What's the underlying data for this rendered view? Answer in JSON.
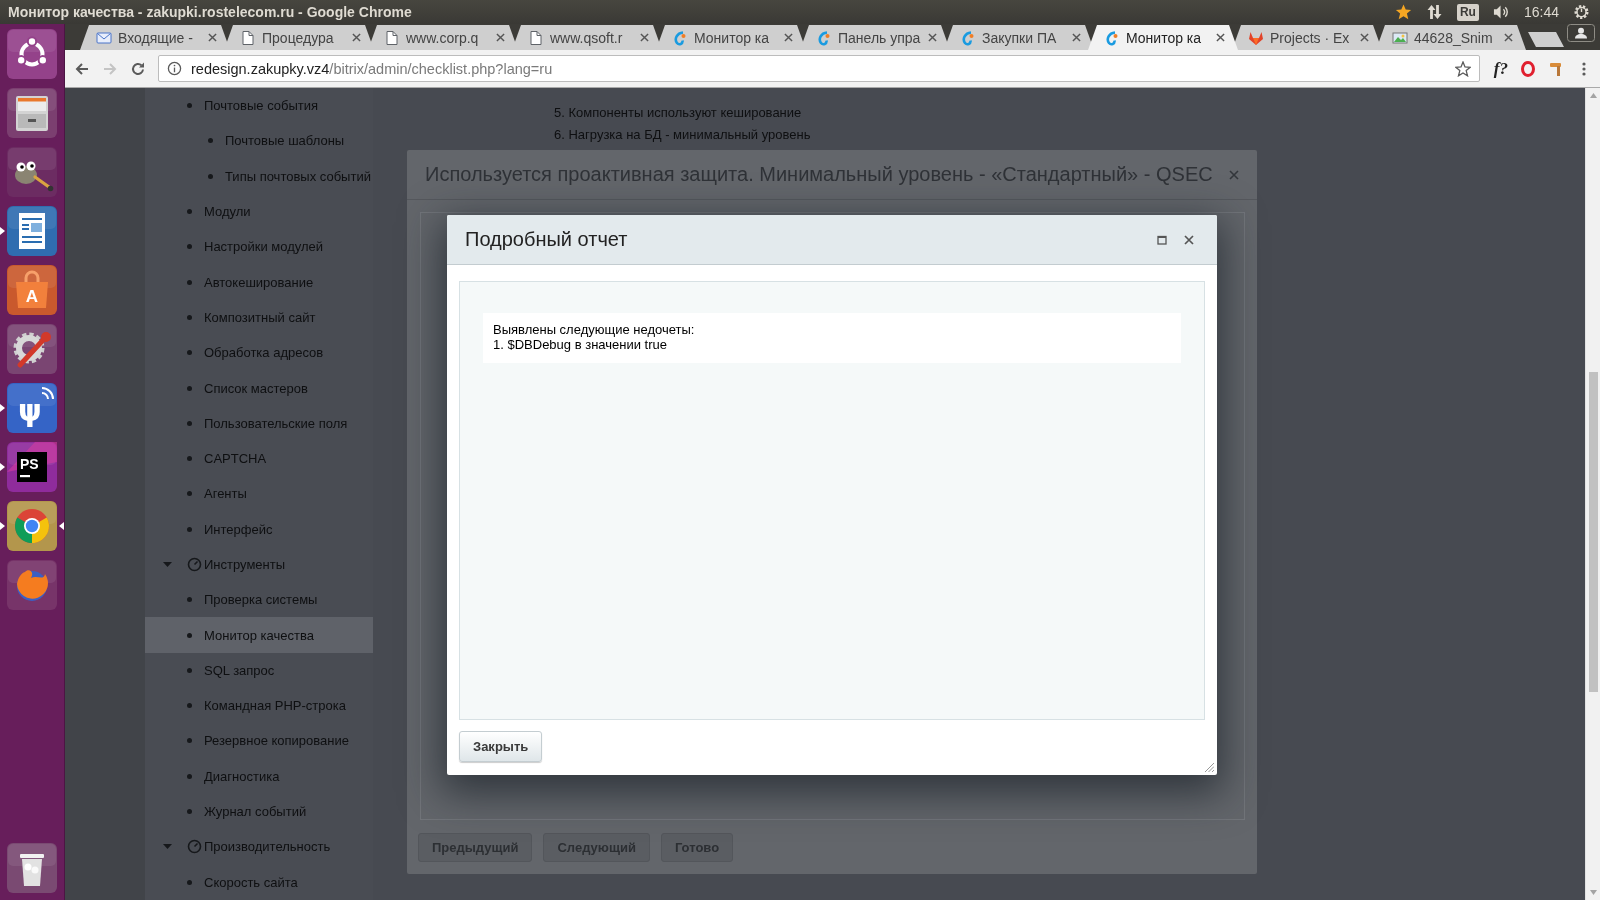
{
  "panel": {
    "title": "Монитор качества - zakupki.rostelecom.ru - Google Chrome",
    "keyboard": "Ru",
    "clock": "16:44"
  },
  "launcher": {
    "items": [
      {
        "kind": "dash",
        "running": false,
        "selected": false
      },
      {
        "kind": "files",
        "running": false,
        "selected": false
      },
      {
        "kind": "gimp",
        "running": false,
        "selected": false
      },
      {
        "kind": "writer",
        "running": true,
        "selected": false
      },
      {
        "kind": "store",
        "glyph": "A",
        "running": false,
        "selected": false
      },
      {
        "kind": "settings",
        "running": false,
        "selected": false
      },
      {
        "kind": "psi",
        "glyph": "ψ",
        "running": true,
        "selected": false
      },
      {
        "kind": "ide",
        "glyph": "PS",
        "running": true,
        "selected": false
      },
      {
        "kind": "browser",
        "running": true,
        "selected": true
      },
      {
        "kind": "firefox",
        "running": false,
        "selected": false
      },
      {
        "kind": "trash",
        "running": false,
        "selected": false
      }
    ]
  },
  "tabs": [
    {
      "title": "Входящие -",
      "kind": "envelope",
      "selected": false
    },
    {
      "title": "Процедура",
      "kind": "page",
      "selected": false
    },
    {
      "title": "www.corp.q",
      "kind": "page",
      "selected": false
    },
    {
      "title": "www.qsoft.r",
      "kind": "page",
      "selected": false
    },
    {
      "title": "Монитор ка",
      "kind": "swirl",
      "selected": false
    },
    {
      "title": "Панель упра",
      "kind": "swirl",
      "selected": false
    },
    {
      "title": "Закупки ПА",
      "kind": "swirl",
      "selected": false
    },
    {
      "title": "Монитор ка",
      "kind": "swirl",
      "selected": true
    },
    {
      "title": "Projects · Ex",
      "kind": "fox",
      "selected": false
    },
    {
      "title": "44628_Snim",
      "kind": "picture",
      "selected": false
    }
  ],
  "toolbar": {
    "back": {
      "disabled": false
    },
    "forward": {
      "disabled": true
    },
    "url_host": "redesign.zakupky.vz4",
    "url_path": "/bitrix/admin/checklist.php?lang=ru",
    "extension": "f?"
  },
  "sidebar": {
    "items": [
      {
        "label": "Почтовые события",
        "kind": "item",
        "selected": false,
        "children": [
          {
            "label": "Почтовые шаблоны",
            "kind": "item",
            "selected": false
          },
          {
            "label": "Типы почтовых событий",
            "kind": "item",
            "selected": false
          }
        ]
      },
      {
        "label": "Модули",
        "kind": "item",
        "selected": false
      },
      {
        "label": "Настройки модулей",
        "kind": "item",
        "selected": false
      },
      {
        "label": "Автокеширование",
        "kind": "item",
        "selected": false
      },
      {
        "label": "Композитный сайт",
        "kind": "item",
        "selected": false
      },
      {
        "label": "Обработка адресов",
        "kind": "item",
        "selected": false
      },
      {
        "label": "Список мастеров",
        "kind": "item",
        "selected": false
      },
      {
        "label": "Пользовательские поля",
        "kind": "item",
        "selected": false
      },
      {
        "label": "CAPTCHA",
        "kind": "item",
        "selected": false
      },
      {
        "label": "Агенты",
        "kind": "item",
        "selected": false
      },
      {
        "label": "Интерфейс",
        "kind": "item",
        "selected": false
      },
      {
        "label": "Инструменты",
        "kind": "section",
        "expanded": true,
        "selected": false,
        "children": [
          {
            "label": "Проверка системы",
            "kind": "item",
            "selected": false
          },
          {
            "label": "Монитор качества",
            "kind": "item",
            "selected": true
          },
          {
            "label": "SQL запрос",
            "kind": "item",
            "selected": false
          },
          {
            "label": "Командная PHP-строка",
            "kind": "item",
            "selected": false
          },
          {
            "label": "Резервное копирование",
            "kind": "item",
            "selected": false
          },
          {
            "label": "Диагностика",
            "kind": "item",
            "selected": false
          },
          {
            "label": "Журнал событий",
            "kind": "item",
            "selected": false
          }
        ]
      },
      {
        "label": "Производительность",
        "kind": "section",
        "expanded": true,
        "selected": false,
        "children": [
          {
            "label": "Скорость сайта",
            "kind": "item",
            "selected": false
          }
        ]
      }
    ]
  },
  "content": {
    "lines": [
      "5. Компоненты используют кеширование",
      "6. Нагрузка на БД - минимальный уровень"
    ]
  },
  "checklist_dialog": {
    "title": "Используется проактивная защита. Минимальный уровень - «Стандартный» - QSEC",
    "buttons": [
      "Предыдущий",
      "Следующий",
      "Готово"
    ]
  },
  "report_dialog": {
    "title": "Подробный отчет",
    "lines": [
      "Выявлены следующие недочеты:",
      "1. $DBDebug в значении true"
    ],
    "button": "Закрыть"
  }
}
